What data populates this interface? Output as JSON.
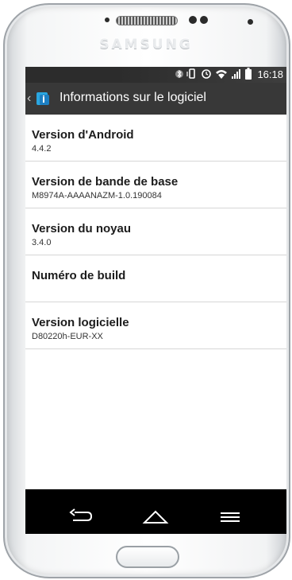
{
  "device": {
    "brand": "SAMSUNG"
  },
  "status_bar": {
    "time": "16:18",
    "icons": [
      "bluetooth-icon",
      "vibrate-icon",
      "alarm-icon",
      "wifi-icon",
      "signal-icon",
      "battery-icon"
    ]
  },
  "action_bar": {
    "title": "Informations sur le logiciel"
  },
  "items": [
    {
      "title": "Version d'Android",
      "value": "4.4.2"
    },
    {
      "title": "Version de bande de base",
      "value": "M8974A-AAAANAZM-1.0.190084"
    },
    {
      "title": "Version du noyau",
      "value": "3.4.0"
    },
    {
      "title": "Numéro de build",
      "value": ""
    },
    {
      "title": "Version logicielle",
      "value": "D80220h-EUR-XX"
    }
  ],
  "nav_bar": {
    "buttons": [
      "back-icon",
      "home-icon",
      "menu-icon"
    ]
  },
  "colors": {
    "status_bar": "#2c2c2c",
    "action_bar": "#383838",
    "accent": "#2aa6e0"
  }
}
